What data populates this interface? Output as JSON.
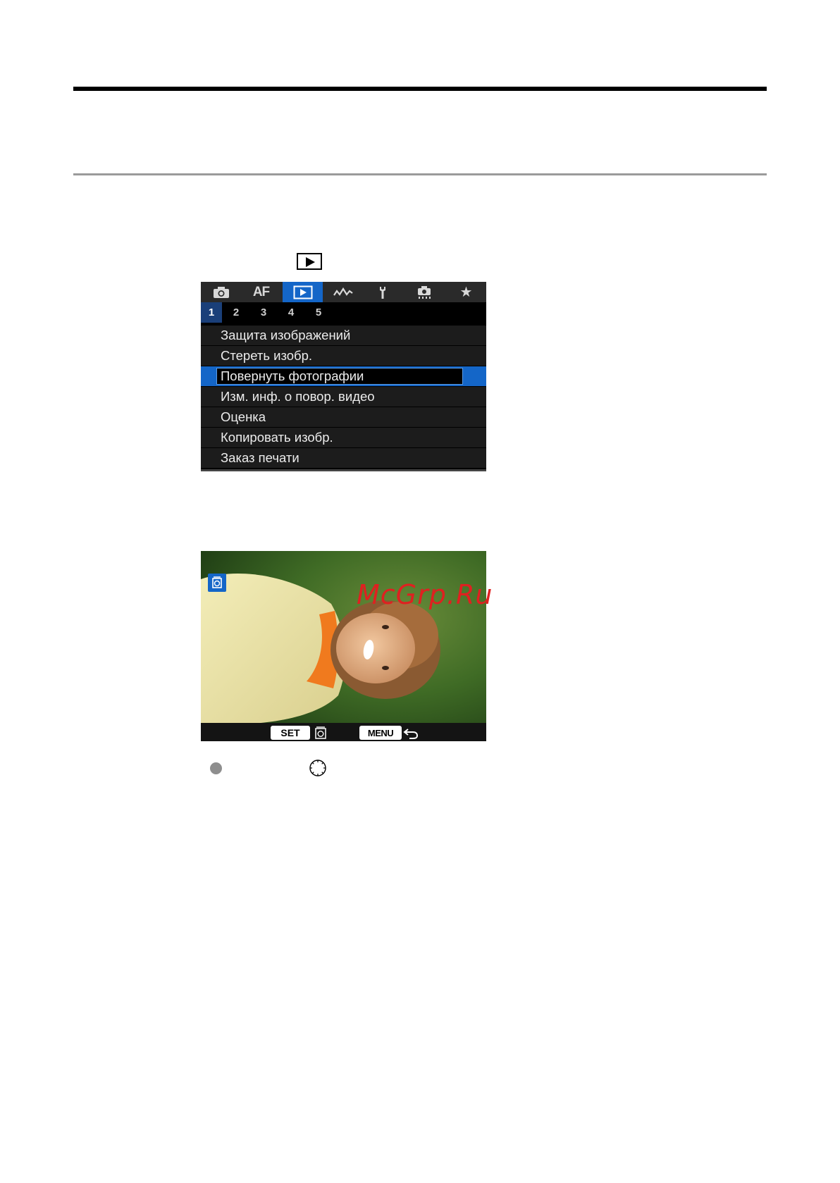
{
  "colors": {
    "accent": "#1466c8",
    "menu_bg": "#000000",
    "watermark": "#e02020"
  },
  "inline_icon": "playback-icon",
  "menu": {
    "tabs": [
      {
        "icon": "camera-icon"
      },
      {
        "label": "AF"
      },
      {
        "icon": "playback-icon",
        "active": true
      },
      {
        "icon": "wireless-icon"
      },
      {
        "icon": "wrench-icon"
      },
      {
        "icon": "custom-functions-icon"
      },
      {
        "label": "★"
      }
    ],
    "pages": [
      "1",
      "2",
      "3",
      "4",
      "5"
    ],
    "active_page": "1",
    "items": [
      "Защита изображений",
      "Стереть изобр.",
      "Повернуть фотографии",
      "Изм. инф. о повор. видео",
      "Оценка",
      "Копировать изобр.",
      "Заказ печати"
    ],
    "selected_item": "Повернуть фотографии"
  },
  "photo_screen": {
    "set_label": "SET",
    "menu_label": "MENU",
    "icons": [
      "rotate-icon",
      "back-arrow-icon"
    ]
  },
  "watermark": "McGrp.Ru",
  "footer_icons": [
    "bullet-icon",
    "main-dial-icon"
  ]
}
